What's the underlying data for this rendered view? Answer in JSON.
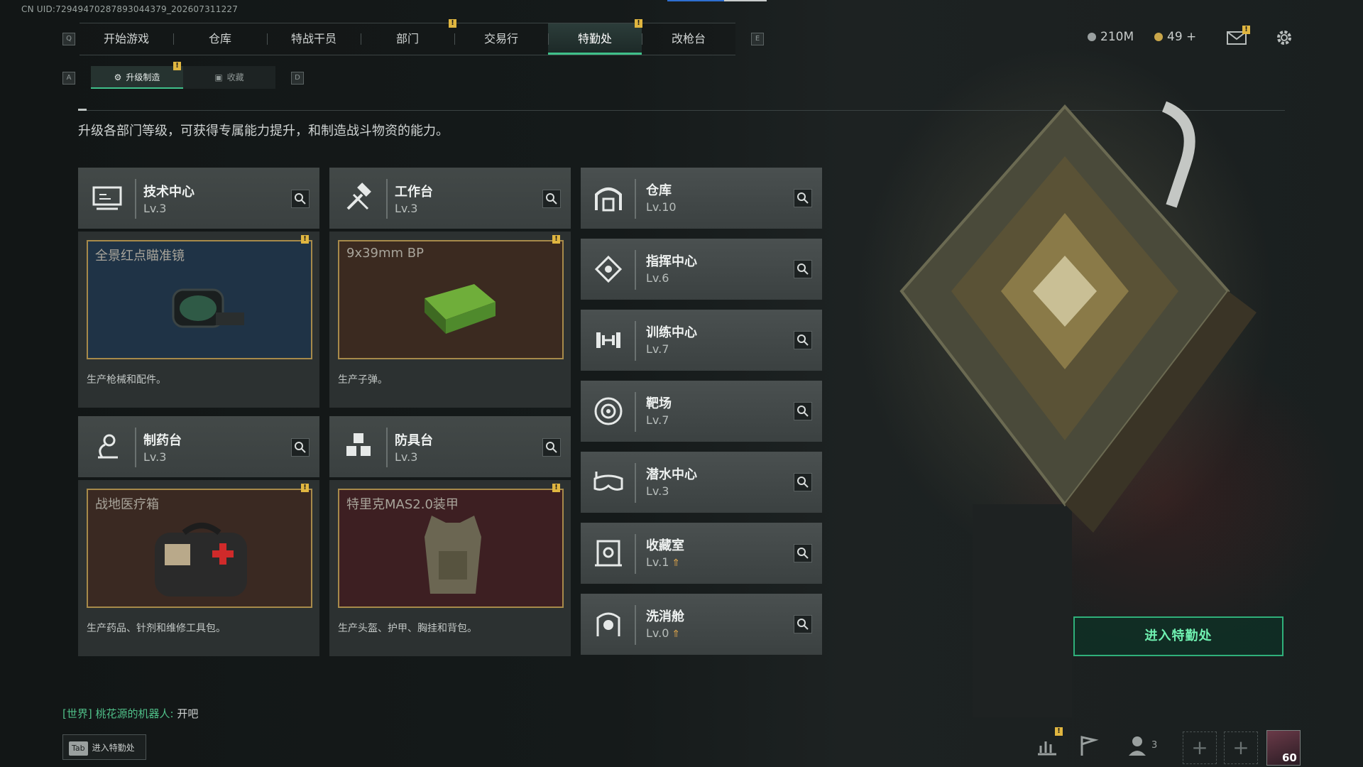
{
  "header": {
    "uid": "CN UID:7294947028789304437​9_202607311227",
    "nav_key_left": "Q",
    "nav_key_right": "E",
    "tabs": [
      {
        "label": "开始游戏"
      },
      {
        "label": "仓库"
      },
      {
        "label": "特战干员"
      },
      {
        "label": "部门"
      },
      {
        "label": "交易行"
      },
      {
        "label": "特勤处"
      },
      {
        "label": "改枪台"
      }
    ],
    "active_tab": "特勤处",
    "currency_1": "210M",
    "currency_2": "49 +",
    "notif_mark": "!"
  },
  "subnav": {
    "key_left": "A",
    "key_right": "D",
    "tabs": [
      {
        "label": "升级制造"
      },
      {
        "label": "收藏"
      }
    ],
    "active": "升级制造"
  },
  "description": "升级各部门等级，可获得专属能力提升，和制造战斗物资的能力。",
  "production_cards": [
    {
      "name": "技术中心",
      "level": "Lv.3",
      "item": "全景红点瞄准镜",
      "desc": "生产枪械和配件。",
      "preview_color": "#1f3346"
    },
    {
      "name": "工作台",
      "level": "Lv.3",
      "item": "9x39mm BP",
      "desc": "生产子弹。",
      "preview_color": "#3b2a20"
    },
    {
      "name": "制药台",
      "level": "Lv.3",
      "item": "战地医疗箱",
      "desc": "生产药品、针剂和维修工具包。",
      "preview_color": "#3a2922"
    },
    {
      "name": "防具台",
      "level": "Lv.3",
      "item": "特里克MAS2.0装甲",
      "desc": "生产头盔、护甲、胸挂和背包。",
      "preview_color": "#3d1f22"
    }
  ],
  "facilities": [
    {
      "name": "仓库",
      "level": "Lv.10",
      "icon": "warehouse-icon"
    },
    {
      "name": "指挥中心",
      "level": "Lv.6",
      "icon": "command-center-icon"
    },
    {
      "name": "训练中心",
      "level": "Lv.7",
      "icon": "dumbbell-icon"
    },
    {
      "name": "靶场",
      "level": "Lv.7",
      "icon": "target-icon"
    },
    {
      "name": "潜水中心",
      "level": "Lv.3",
      "icon": "diving-mask-icon"
    },
    {
      "name": "收藏室",
      "level": "Lv.1",
      "icon": "collection-icon",
      "upgradable": true
    },
    {
      "name": "洗消舱",
      "level": "Lv.0",
      "icon": "decontamination-icon",
      "upgradable": true
    }
  ],
  "enter_button": "进入特勤处",
  "chat": {
    "channel": "[世界]",
    "user": "桃花源的机器人:",
    "message": "开吧"
  },
  "tab_hint": {
    "key": "Tab",
    "label": "进入特勤处"
  },
  "hud": {
    "friends_count": "3",
    "player_level": "60"
  },
  "colors": {
    "accent_green": "#3fc08a",
    "notif_yellow": "#e0b640",
    "preview_border": "#a78a4a"
  }
}
